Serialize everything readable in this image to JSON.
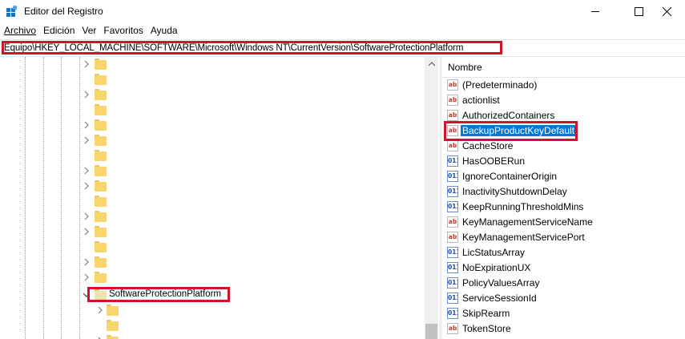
{
  "window": {
    "title": "Editor del Registro",
    "icon": "registry-editor-icon"
  },
  "menu": {
    "items": [
      {
        "label": "Archivo"
      },
      {
        "label": "Edición"
      },
      {
        "label": "Ver"
      },
      {
        "label": "Favoritos"
      },
      {
        "label": "Ayuda"
      }
    ]
  },
  "address": {
    "path": "Equipo\\HKEY_LOCAL_MACHINE\\SOFTWARE\\Microsoft\\Windows NT\\CurrentVersion\\SoftwareProtectionPlatform"
  },
  "tree": {
    "selected_key": "SoftwareProtectionPlatform"
  },
  "values": {
    "column_header": "Nombre",
    "items": [
      {
        "name": "(Predeterminado)",
        "type": "string"
      },
      {
        "name": "actionlist",
        "type": "string"
      },
      {
        "name": "AuthorizedContainers",
        "type": "string"
      },
      {
        "name": "BackupProductKeyDefault",
        "type": "string",
        "selected": true
      },
      {
        "name": "CacheStore",
        "type": "string"
      },
      {
        "name": "HasOOBERun",
        "type": "binary"
      },
      {
        "name": "IgnoreContainerOrigin",
        "type": "binary"
      },
      {
        "name": "InactivityShutdownDelay",
        "type": "binary"
      },
      {
        "name": "KeepRunningThresholdMins",
        "type": "binary"
      },
      {
        "name": "KeyManagementServiceName",
        "type": "string"
      },
      {
        "name": "KeyManagementServicePort",
        "type": "string"
      },
      {
        "name": "LicStatusArray",
        "type": "binary"
      },
      {
        "name": "NoExpirationUX",
        "type": "binary"
      },
      {
        "name": "PolicyValuesArray",
        "type": "binary"
      },
      {
        "name": "ServiceSessionId",
        "type": "binary"
      },
      {
        "name": "SkipRearm",
        "type": "binary"
      },
      {
        "name": "TokenStore",
        "type": "string"
      }
    ]
  },
  "colors": {
    "highlight": "#d0142c",
    "selection": "#0078d7",
    "folder": "#f9d56e"
  }
}
